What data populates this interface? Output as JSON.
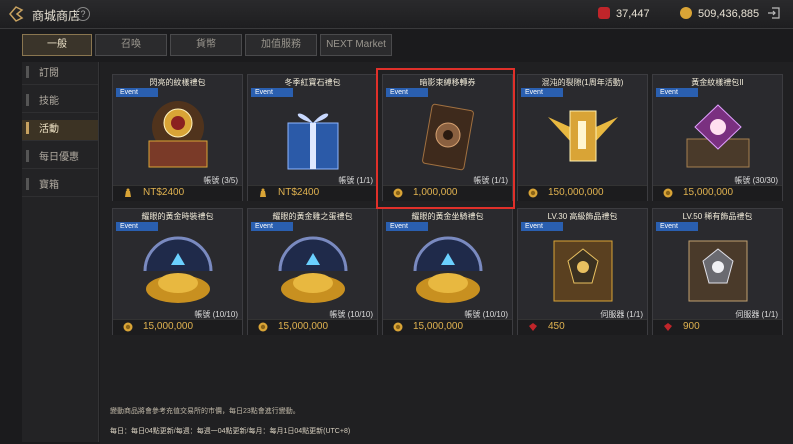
{
  "header": {
    "title": "商城商店",
    "help": "?",
    "currency_red": "37,447",
    "currency_gold": "509,436,885",
    "colors": {
      "red": "#c0252a",
      "gold": "#d9a436"
    }
  },
  "tabs": [
    "一般",
    "召喚",
    "貨幣",
    "加值服務",
    "NEXT Market"
  ],
  "sidebar": [
    "訂閱",
    "技能",
    "活動",
    "每日優惠",
    "寶箱"
  ],
  "cards": [
    {
      "name": "閃亮的紋樣禮包",
      "badge": "Event",
      "limit": "帳號 (3/5)",
      "price": "NT$2400",
      "price_icon": "bag-icon",
      "art": "chest"
    },
    {
      "name": "冬季紅寶石禮包",
      "badge": "Event",
      "limit": "帳號 (1/1)",
      "price": "NT$2400",
      "price_icon": "bag-icon",
      "art": "giftbox"
    },
    {
      "name": "暗影束縛移轉券",
      "badge": "Event",
      "limit": "帳號 (1/1)",
      "price": "1,000,000",
      "price_icon": "gold-coin-icon",
      "art": "ticket"
    },
    {
      "name": "混沌的裂隙(1周年活動)",
      "badge": "Event",
      "limit": "",
      "price": "150,000,000",
      "price_icon": "gold-coin-icon",
      "art": "scroll-wings"
    },
    {
      "name": "黃金紋樣禮包II",
      "badge": "Event",
      "limit": "帳號 (30/30)",
      "price": "15,000,000",
      "price_icon": "gold-coin-icon",
      "art": "gem-chest"
    },
    {
      "name": "耀眼的黃金時裝禮包",
      "badge": "Event",
      "limit": "帳號 (10/10)",
      "price": "15,000,000",
      "price_icon": "gold-coin-icon",
      "art": "gold-pile"
    },
    {
      "name": "耀眼的黃金雞之蛋禮包",
      "badge": "Event",
      "limit": "帳號 (10/10)",
      "price": "15,000,000",
      "price_icon": "gold-coin-icon",
      "art": "gold-pile"
    },
    {
      "name": "耀眼的黃金坐騎禮包",
      "badge": "Event",
      "limit": "帳號 (10/10)",
      "price": "15,000,000",
      "price_icon": "gold-coin-icon",
      "art": "gold-pile"
    },
    {
      "name": "LV.30 高級飾品禮包",
      "badge": "Event",
      "limit": "伺服器 (1/1)",
      "price": "450",
      "price_icon": "red-gem-icon",
      "art": "scroll-crest"
    },
    {
      "name": "LV.50 稀有飾品禮包",
      "badge": "Event",
      "limit": "伺服器 (1/1)",
      "price": "900",
      "price_icon": "red-gem-icon",
      "art": "scroll-crest-silver"
    }
  ],
  "notes": {
    "line1": "變動商品將會參考充值交易所的市價，每日23點會進行變動。",
    "line2": "每日：每日04點更新/每週：每週一04點更新/每月：每月1日04點更新(UTC+8)"
  }
}
